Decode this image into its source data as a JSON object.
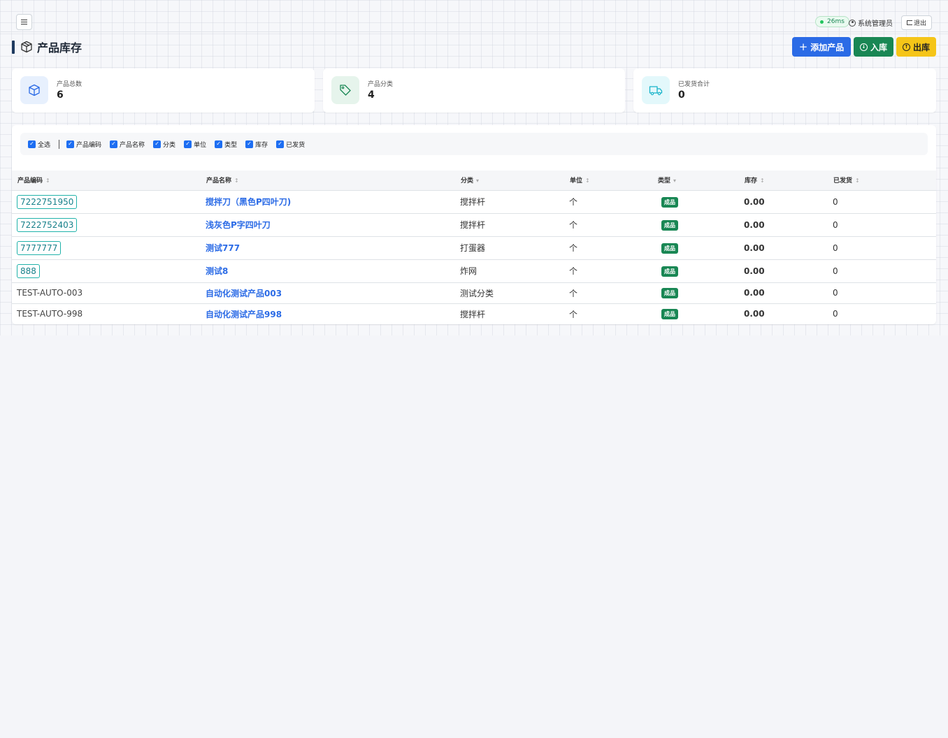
{
  "header": {
    "latency": "26ms",
    "user_name": "系统管理员",
    "logout_label": "退出"
  },
  "page": {
    "title": "产品库存",
    "add_label": "添加产品",
    "in_label": "入库",
    "out_label": "出库"
  },
  "stats": [
    {
      "label": "产品总数",
      "value": "6",
      "icon": "box-icon",
      "color": "#e7f0fd"
    },
    {
      "label": "产品分类",
      "value": "4",
      "icon": "tag-icon",
      "color": "#e6f4ec"
    },
    {
      "label": "已发货合计",
      "value": "0",
      "icon": "truck-icon",
      "color": "#e3f8fb"
    }
  ],
  "column_toggles": {
    "all_label": "全选",
    "items": [
      "产品编码",
      "产品名称",
      "分类",
      "单位",
      "类型",
      "库存",
      "已发货"
    ]
  },
  "table": {
    "headers": [
      "产品编码",
      "产品名称",
      "分类",
      "单位",
      "类型",
      "库存",
      "已发货"
    ],
    "rows": [
      {
        "code": "7222751950",
        "name": "搅拌刀（黑色P四叶刀)",
        "category": "搅拌杆",
        "unit": "个",
        "type": "成品",
        "stock": "0.00",
        "shipped": "0"
      },
      {
        "code": "7222752403",
        "name": "浅灰色P字四叶刀",
        "category": "搅拌杆",
        "unit": "个",
        "type": "成品",
        "stock": "0.00",
        "shipped": "0"
      },
      {
        "code": "7777777",
        "name": "测试777",
        "category": "打蛋器",
        "unit": "个",
        "type": "成品",
        "stock": "0.00",
        "shipped": "0"
      },
      {
        "code": "888",
        "name": "测试8",
        "category": "炸网",
        "unit": "个",
        "type": "成品",
        "stock": "0.00",
        "shipped": "0"
      },
      {
        "code": "TEST-AUTO-003",
        "name": "自动化测试产品003",
        "category": "测试分类",
        "unit": "个",
        "type": "成品",
        "stock": "0.00",
        "shipped": "0"
      },
      {
        "code": "TEST-AUTO-998",
        "name": "自动化测试产品998",
        "category": "搅拌杆",
        "unit": "个",
        "type": "成品",
        "stock": "0.00",
        "shipped": "0"
      }
    ]
  },
  "colors": {
    "primary": "#2b6be6",
    "success": "#198754",
    "warning": "#f5c518",
    "code_border": "#20b2aa"
  }
}
